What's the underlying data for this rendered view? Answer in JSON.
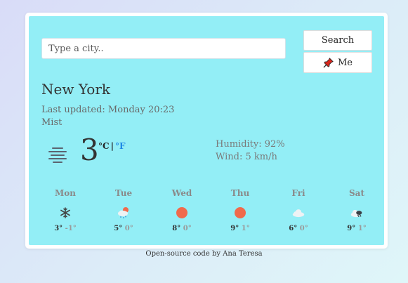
{
  "search": {
    "placeholder": "Type a city..",
    "value": "",
    "search_label": "Search",
    "me_label": "Me",
    "me_icon": "pushpin-icon"
  },
  "current": {
    "city": "New York",
    "updated": "Last updated: Monday 20:23",
    "description": "Mist",
    "icon": "mist-icon",
    "temperature": "3",
    "unit_c": "°C",
    "unit_sep": "|",
    "unit_f": "°F",
    "humidity": "Humidity: 92%",
    "wind": "Wind: 5 km/h"
  },
  "forecast": [
    {
      "day": "Mon",
      "icon": "snowflake-icon",
      "max": "3°",
      "min": "-1°"
    },
    {
      "day": "Tue",
      "icon": "sun-cloud-snow-icon",
      "max": "5°",
      "min": "0°"
    },
    {
      "day": "Wed",
      "icon": "sun-icon",
      "max": "8°",
      "min": "0°"
    },
    {
      "day": "Thu",
      "icon": "sun-icon",
      "max": "9°",
      "min": "1°"
    },
    {
      "day": "Fri",
      "icon": "cloud-icon",
      "max": "6°",
      "min": "0°"
    },
    {
      "day": "Sat",
      "icon": "cloud-rain-icon",
      "max": "9°",
      "min": "1°"
    }
  ],
  "footer": {
    "link_text": "Open-source code",
    "suffix": " by Ana Teresa"
  },
  "colors": {
    "panel": "#93eef6",
    "accent_link": "#1e88e5",
    "sun": "#f06a4c"
  }
}
